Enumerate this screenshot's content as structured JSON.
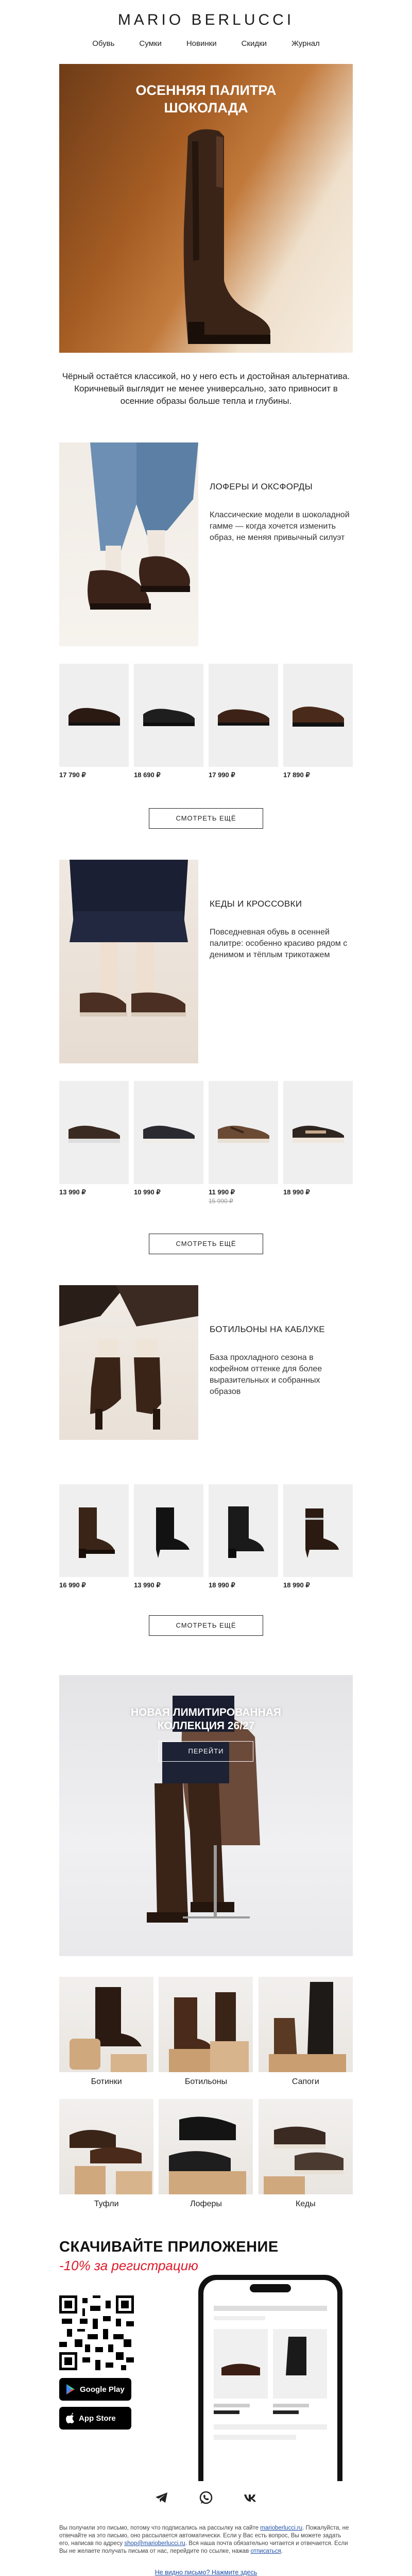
{
  "brand": "MARIO BERLUCCI",
  "nav": [
    "Обувь",
    "Сумки",
    "Новинки",
    "Скидки",
    "Журнал"
  ],
  "hero": {
    "title_line1": "ОСЕННЯЯ ПАЛИТРА",
    "title_line2": "ШОКОЛАДА",
    "text": "Чёрный остаётся классикой, но у него есть и достойная альтернатива. Коричневый выглядит не менее универсально, зато привносит в осенние образы больше тепла и глубины."
  },
  "sections": [
    {
      "title": "ЛОФЕРЫ И ОКСФОРДЫ",
      "desc": "Классические модели в шоколадной гамме — когда хочется изменить образ, не меняя привычный силуэт",
      "prices": [
        "17 790 ₽",
        "18 690 ₽",
        "17 990 ₽",
        "17 890 ₽"
      ],
      "button": "СМОТРЕТЬ ЕЩЁ"
    },
    {
      "title": "КЕДЫ И КРОССОВКИ",
      "desc": "Повседневная обувь в осенней палитре: особенно красиво рядом с денимом и тёплым трикотажем",
      "prices": [
        "13 990 ₽",
        "10 990 ₽",
        "11 990 ₽",
        "18 990 ₽"
      ],
      "old_price": "15 990 ₽",
      "button": "СМОТРЕТЬ ЕЩЁ"
    },
    {
      "title": "БОТИЛЬОНЫ НА КАБЛУКЕ",
      "desc": "База прохладного сезона в кофейном оттенке для более выразительных и собранных образов",
      "prices": [
        "16 990 ₽",
        "13 990 ₽",
        "18 990 ₽",
        "18 990 ₽"
      ],
      "button": "СМОТРЕТЬ ЕЩЁ"
    }
  ],
  "promo": {
    "title_line1": "НОВАЯ ЛИМИТИРОВАННАЯ",
    "title_line2": "КОЛЛЕКЦИЯ 26/27",
    "button": "ПЕРЕЙТИ"
  },
  "categories": [
    "Ботинки",
    "Ботильоны",
    "Сапоги",
    "Туфли",
    "Лоферы",
    "Кеды"
  ],
  "app": {
    "title": "СКАЧИВАЙТЕ ПРИЛОЖЕНИЕ",
    "subtitle": "-10% за регистрацию",
    "google_play": "Google Play",
    "app_store": "App Store"
  },
  "socials": [
    "telegram-icon",
    "whatsapp-icon",
    "vk-icon"
  ],
  "legal": {
    "p1": "Вы получили это письмо, потому что подписались на рассылку на сайте",
    "site_link": "marioberlucci.ru",
    "p2": ". Пожалуйста, не отвечайте на это письмо, оно рассылается автоматически. Если у Вас есть вопрос, Вы можете задать его, написав по адресу",
    "email_link": "shop@marioberlucci.ru",
    "p3": ". Вся наша почта обязательно читается и отвечается. Если Вы не желаете получать письма от нас, перейдите по ссылке, нажав",
    "unsub_link": "отписаться"
  },
  "browser_link": "Не видно письмо? Нажмите здесь",
  "colors": {
    "accent_red": "#e0192a",
    "link_blue": "#2251a8",
    "chocolate": "#4a2a1a"
  }
}
